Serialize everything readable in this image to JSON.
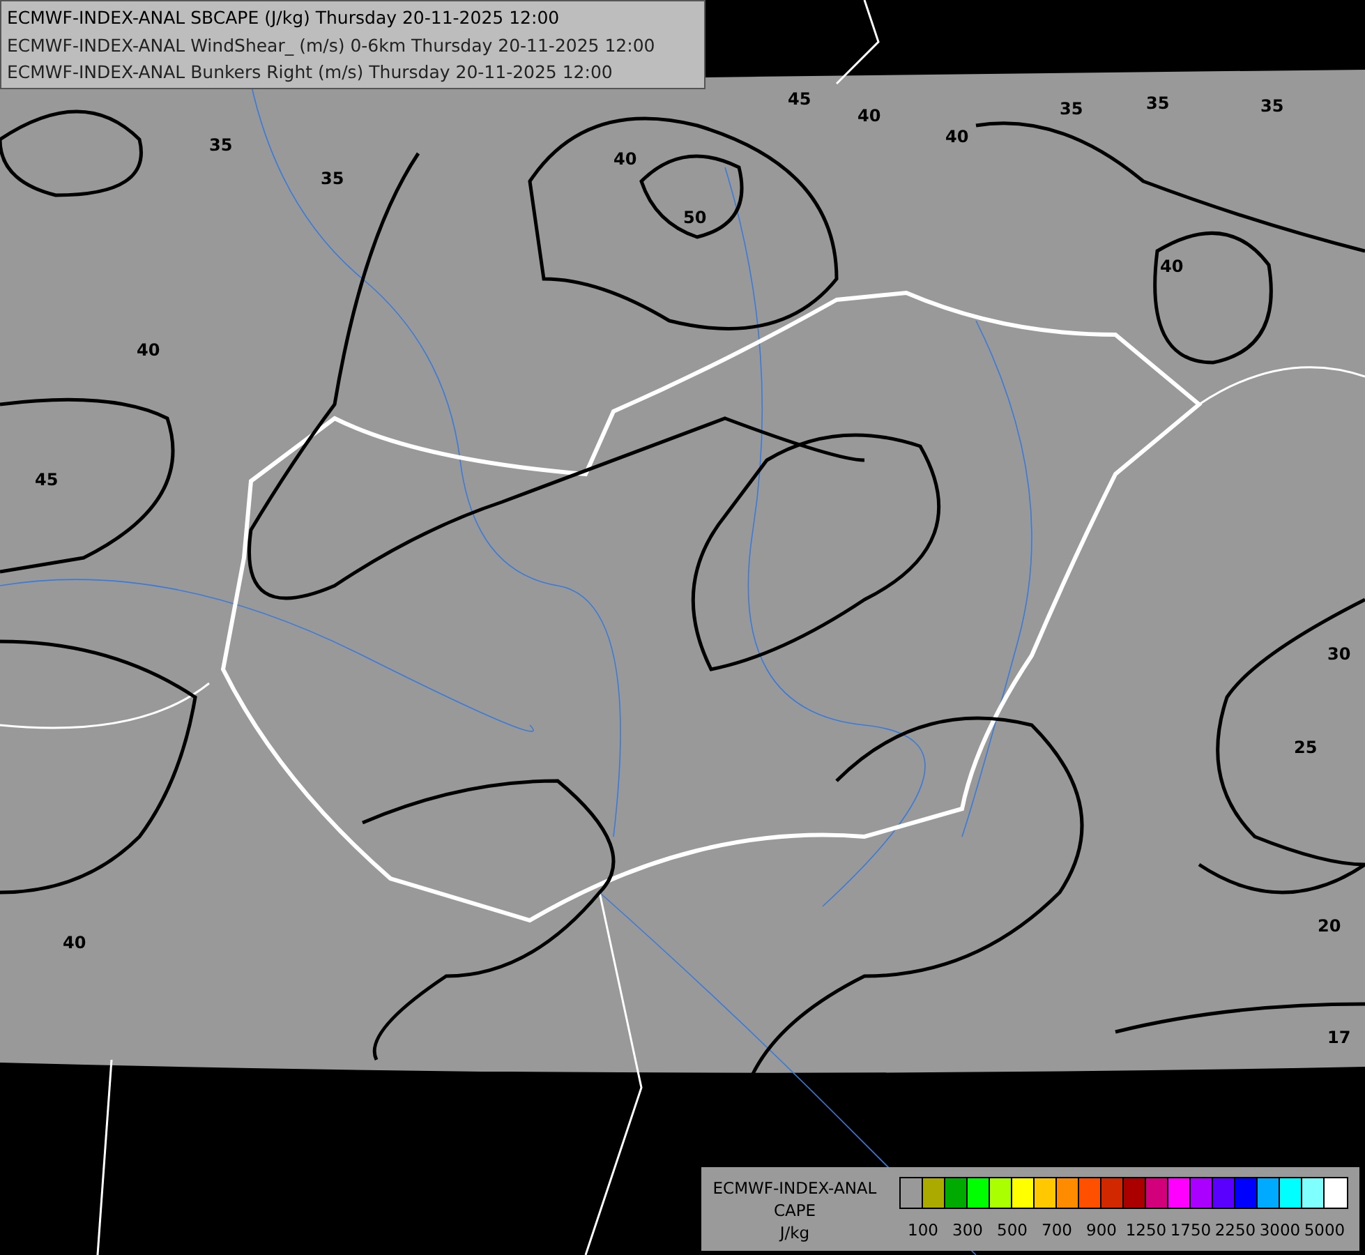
{
  "header": {
    "lines": [
      "ECMWF-INDEX-ANAL SBCAPE (J/kg) Thursday 20-11-2025 12:00",
      "ECMWF-INDEX-ANAL WindShear_ (m/s) 0-6km Thursday 20-11-2025 12:00",
      "ECMWF-INDEX-ANAL Bunkers Right (m/s) Thursday 20-11-2025 12:00"
    ]
  },
  "map": {
    "contour_labels": [
      "35",
      "35",
      "40",
      "45",
      "50",
      "40",
      "40",
      "35",
      "35",
      "35",
      "40",
      "45",
      "40",
      "30",
      "25",
      "20",
      "17",
      "40"
    ]
  },
  "legend": {
    "title_lines": [
      "ECMWF-INDEX-ANAL",
      "CAPE",
      "J/kg"
    ],
    "swatches": [
      {
        "color": "#999999"
      },
      {
        "color": "#aaaa00"
      },
      {
        "color": "#00aa00"
      },
      {
        "color": "#00ff00"
      },
      {
        "color": "#aaff00"
      },
      {
        "color": "#ffff00"
      },
      {
        "color": "#ffc800"
      },
      {
        "color": "#ff8c00"
      },
      {
        "color": "#ff5000"
      },
      {
        "color": "#d22800"
      },
      {
        "color": "#aa0000"
      },
      {
        "color": "#d2007a"
      },
      {
        "color": "#ff00ff"
      },
      {
        "color": "#aa00ff"
      },
      {
        "color": "#5a00ff"
      },
      {
        "color": "#0000ff"
      },
      {
        "color": "#00aaff"
      },
      {
        "color": "#00ffff"
      },
      {
        "color": "#80ffff"
      },
      {
        "color": "#ffffff"
      }
    ],
    "ticks": [
      "100",
      "300",
      "500",
      "700",
      "900",
      "1250",
      "1750",
      "2250",
      "3000",
      "5000"
    ]
  }
}
